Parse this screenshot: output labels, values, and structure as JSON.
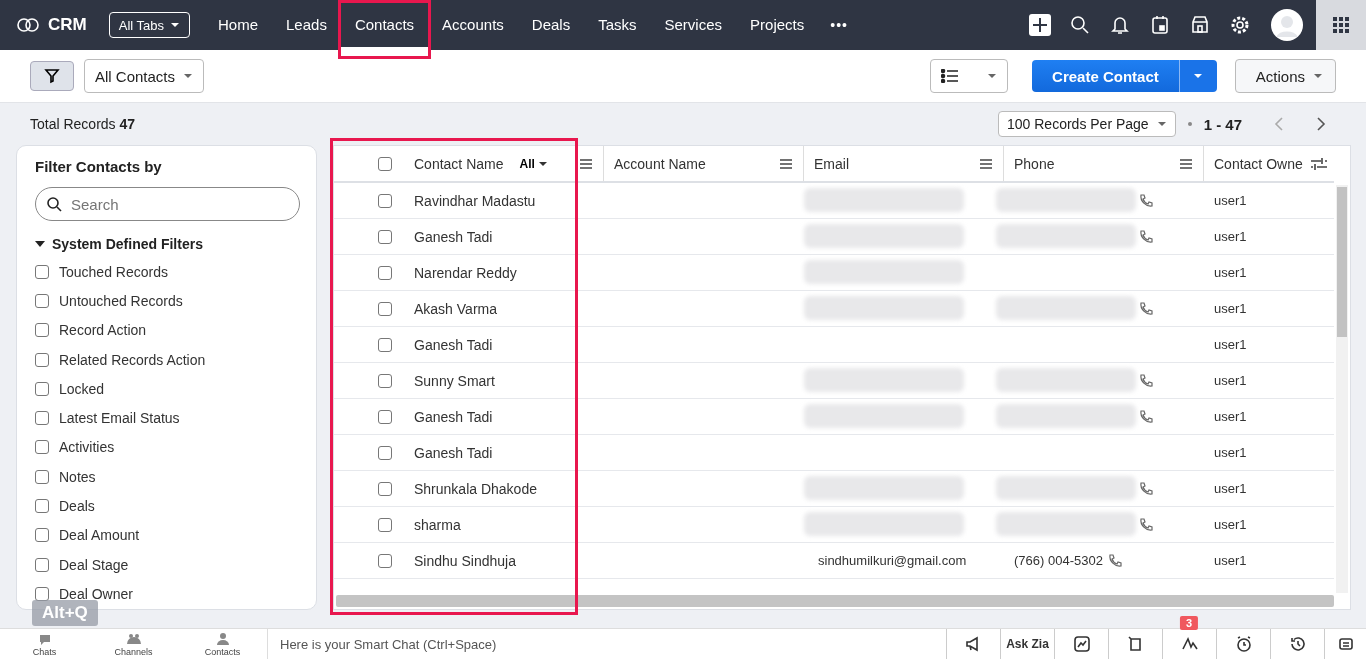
{
  "topbar": {
    "logo": "CRM",
    "all_tabs": "All Tabs",
    "tabs": [
      {
        "label": "Home",
        "selected": false,
        "highlight": false
      },
      {
        "label": "Leads",
        "selected": false,
        "highlight": false
      },
      {
        "label": "Contacts",
        "selected": true,
        "highlight": true
      },
      {
        "label": "Accounts",
        "selected": false,
        "highlight": false
      },
      {
        "label": "Deals",
        "selected": false,
        "highlight": false
      },
      {
        "label": "Tasks",
        "selected": false,
        "highlight": false
      },
      {
        "label": "Services",
        "selected": false,
        "highlight": false
      },
      {
        "label": "Projects",
        "selected": false,
        "highlight": false
      }
    ],
    "more": "•••"
  },
  "toolbar": {
    "view": "All Contacts",
    "create": "Create Contact",
    "actions": "Actions"
  },
  "summary": {
    "total_label": "Total Records",
    "total": "47",
    "per_page": "100 Records Per Page",
    "range": "1 - 47"
  },
  "filters": {
    "title": "Filter Contacts by",
    "search_placeholder": "Search",
    "section": "System Defined Filters",
    "expanded": true,
    "items": [
      {
        "label": "Touched Records",
        "checked": false
      },
      {
        "label": "Untouched Records",
        "checked": false
      },
      {
        "label": "Record Action",
        "checked": false
      },
      {
        "label": "Related Records Action",
        "checked": false
      },
      {
        "label": "Locked",
        "checked": false
      },
      {
        "label": "Latest Email Status",
        "checked": false
      },
      {
        "label": "Activities",
        "checked": false
      },
      {
        "label": "Notes",
        "checked": false
      },
      {
        "label": "Deals",
        "checked": false
      },
      {
        "label": "Deal Amount",
        "checked": false
      },
      {
        "label": "Deal Stage",
        "checked": false
      },
      {
        "label": "Deal Owner",
        "checked": false
      }
    ]
  },
  "table": {
    "all_checked": false,
    "name_filter": "All",
    "name_column_highlight": true,
    "columns": [
      "Contact Name",
      "Account Name",
      "Email",
      "Phone",
      "Contact Owne"
    ],
    "rows": [
      {
        "name": "Ravindhar Madastu",
        "checked": false,
        "email_blurred": true,
        "phone_blurred": true,
        "phone_icon": true,
        "owner": "user1"
      },
      {
        "name": "Ganesh Tadi",
        "checked": false,
        "email_blurred": true,
        "phone_blurred": true,
        "phone_icon": true,
        "owner": "user1"
      },
      {
        "name": "Narendar Reddy",
        "checked": false,
        "email_blurred": true,
        "phone_blurred": false,
        "phone_icon": false,
        "owner": "user1"
      },
      {
        "name": "Akash Varma",
        "checked": false,
        "email_blurred": true,
        "phone_blurred": true,
        "phone_icon": true,
        "owner": "user1"
      },
      {
        "name": "Ganesh Tadi",
        "checked": false,
        "email_blurred": false,
        "phone_blurred": false,
        "phone_icon": false,
        "owner": "user1"
      },
      {
        "name": "Sunny Smart",
        "checked": false,
        "email_blurred": true,
        "phone_blurred": true,
        "phone_icon": true,
        "owner": "user1"
      },
      {
        "name": "Ganesh Tadi",
        "checked": false,
        "email_blurred": true,
        "phone_blurred": true,
        "phone_icon": true,
        "owner": "user1"
      },
      {
        "name": "Ganesh Tadi",
        "checked": false,
        "email_blurred": false,
        "phone_blurred": false,
        "phone_icon": false,
        "owner": "user1"
      },
      {
        "name": "Shrunkala Dhakode",
        "checked": false,
        "email_blurred": true,
        "phone_blurred": true,
        "phone_icon": true,
        "owner": "user1"
      },
      {
        "name": "sharma",
        "checked": false,
        "email_blurred": true,
        "phone_blurred": true,
        "phone_icon": true,
        "owner": "user1"
      },
      {
        "name": "Sindhu Sindhuja",
        "checked": false,
        "email_blurred": false,
        "phone_blurred": false,
        "phone_icon": true,
        "email": "sindhumilkuri@gmail.com",
        "phone": "(766) 004-5302",
        "owner": "user1"
      }
    ]
  },
  "shortcut": "Alt+Q",
  "bottombar": {
    "items": [
      "Chats",
      "Channels",
      "Contacts"
    ],
    "chat_placeholder": "Here is your Smart Chat (Ctrl+Space)",
    "ask_zia": "Ask Zia",
    "badge": "3"
  }
}
